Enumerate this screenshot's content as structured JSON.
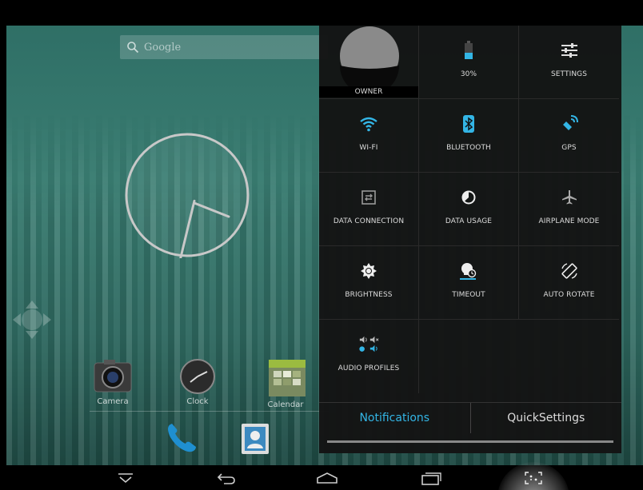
{
  "home": {
    "search_placeholder": "Google",
    "apps": [
      {
        "label": "Camera"
      },
      {
        "label": "Clock"
      },
      {
        "label": "Calendar"
      }
    ]
  },
  "quick_settings": {
    "tiles": [
      {
        "label": "OWNER",
        "icon": "user-avatar-icon"
      },
      {
        "label": "30%",
        "icon": "battery-icon"
      },
      {
        "label": "SETTINGS",
        "icon": "sliders-icon"
      },
      {
        "label": "WI-FI",
        "icon": "wifi-icon"
      },
      {
        "label": "BLUETOOTH",
        "icon": "bluetooth-icon"
      },
      {
        "label": "GPS",
        "icon": "gps-icon"
      },
      {
        "label": "DATA CONNECTION",
        "icon": "data-connection-icon"
      },
      {
        "label": "DATA USAGE",
        "icon": "data-usage-icon"
      },
      {
        "label": "AIRPLANE MODE",
        "icon": "airplane-icon"
      },
      {
        "label": "BRIGHTNESS",
        "icon": "brightness-icon"
      },
      {
        "label": "TIMEOUT",
        "icon": "timeout-icon"
      },
      {
        "label": "AUTO ROTATE",
        "icon": "auto-rotate-icon"
      },
      {
        "label": "AUDIO PROFILES",
        "icon": "audio-profiles-icon"
      }
    ],
    "tabs": [
      {
        "label": "Notifications",
        "active": true
      },
      {
        "label": "QuickSettings",
        "active": false
      }
    ]
  },
  "colors": {
    "accent": "#33b5e5",
    "panel_bg": "#141414"
  }
}
